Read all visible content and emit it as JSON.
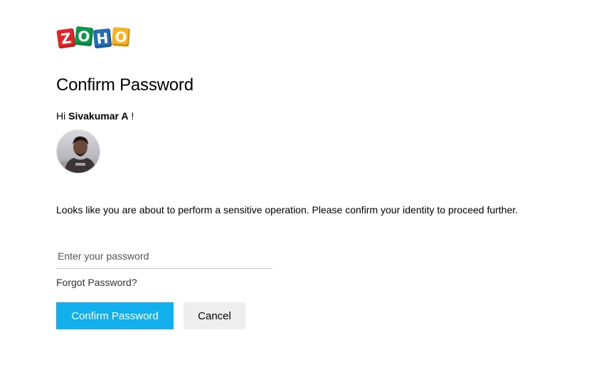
{
  "brand": {
    "logo_letters": [
      "Z",
      "O",
      "H",
      "O"
    ],
    "colors": [
      "#e42527",
      "#089949",
      "#226db4",
      "#f9b21d"
    ]
  },
  "page": {
    "title": "Confirm Password",
    "greeting_prefix": "Hi",
    "user_name": "Sivakumar A",
    "greeting_suffix": "!",
    "description": "Looks like you are about to perform a sensitive operation. Please confirm your identity to proceed further."
  },
  "form": {
    "password_placeholder": "Enter your password",
    "password_value": "",
    "forgot_link": "Forgot Password?",
    "confirm_button": "Confirm Password",
    "cancel_button": "Cancel"
  },
  "theme": {
    "primary": "#11b0ed",
    "secondary_bg": "#eeeeee"
  }
}
